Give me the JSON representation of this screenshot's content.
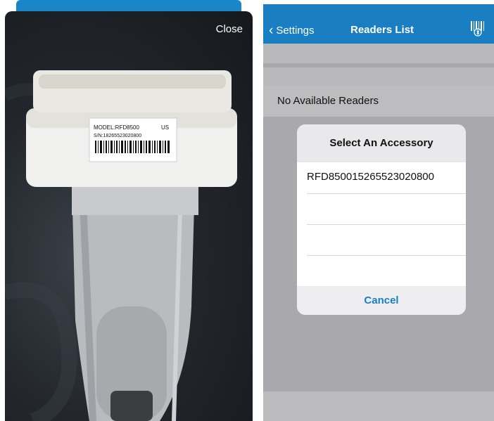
{
  "camera": {
    "close_label": "Close",
    "label_model": "MODEL:RFD8500",
    "label_region": "US",
    "label_serial": "S/N:18265523020800"
  },
  "readers": {
    "back_label": "Settings",
    "title": "Readers List",
    "nav_icon": "barcode-bluetooth-icon",
    "no_readers_text": "No Available Readers",
    "sheet": {
      "title": "Select An Accessory",
      "items": [
        "RFD850015265523020800",
        "",
        "",
        ""
      ],
      "cancel_label": "Cancel"
    }
  },
  "colors": {
    "nav_blue": "#1a7fc2",
    "overlay_gray": "#a9a9ad"
  }
}
